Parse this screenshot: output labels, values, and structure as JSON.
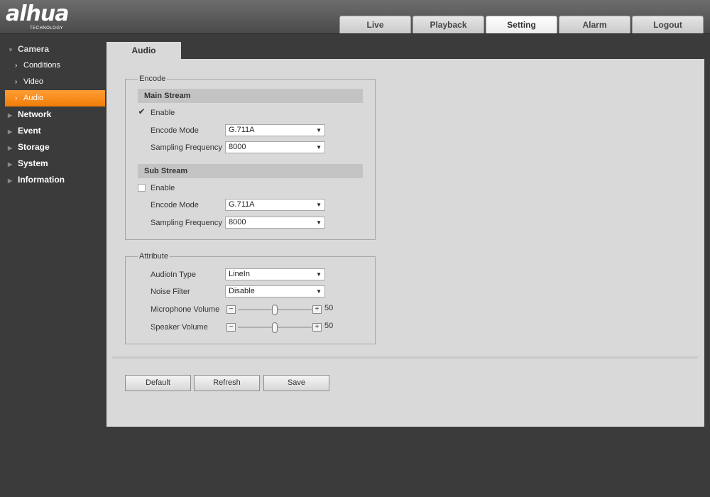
{
  "header": {
    "logo": "alhua",
    "logo_sub": "TECHNOLOGY",
    "tabs": [
      {
        "label": "Live"
      },
      {
        "label": "Playback"
      },
      {
        "label": "Setting"
      },
      {
        "label": "Alarm"
      },
      {
        "label": "Logout"
      }
    ],
    "active_tab": "Setting"
  },
  "sidebar": {
    "groups": [
      {
        "label": "Camera",
        "open": true,
        "items": [
          {
            "label": "Conditions"
          },
          {
            "label": "Video"
          },
          {
            "label": "Audio",
            "active": true
          }
        ]
      },
      {
        "label": "Network"
      },
      {
        "label": "Event"
      },
      {
        "label": "Storage"
      },
      {
        "label": "System"
      },
      {
        "label": "Information"
      }
    ]
  },
  "page": {
    "tab_label": "Audio",
    "encode": {
      "legend": "Encode",
      "main_stream": {
        "heading": "Main Stream",
        "enable_label": "Enable",
        "enabled": true,
        "encode_mode_label": "Encode Mode",
        "encode_mode": "G.711A",
        "sampling_label": "Sampling Frequency",
        "sampling": "8000"
      },
      "sub_stream": {
        "heading": "Sub Stream",
        "enable_label": "Enable",
        "enabled": false,
        "encode_mode_label": "Encode Mode",
        "encode_mode": "G.711A",
        "sampling_label": "Sampling Frequency",
        "sampling": "8000"
      }
    },
    "attribute": {
      "legend": "Attribute",
      "audioin_type_label": "AudioIn Type",
      "audioin_type": "LineIn",
      "noise_filter_label": "Noise Filter",
      "noise_filter": "Disable",
      "mic_volume_label": "Microphone Volume",
      "mic_volume": "50",
      "speaker_volume_label": "Speaker Volume",
      "speaker_volume": "50",
      "minus": "−",
      "plus": "+"
    },
    "buttons": {
      "default": "Default",
      "refresh": "Refresh",
      "save": "Save"
    }
  },
  "colors": {
    "accent": "#f58a1f",
    "panel": "#d9d9d9",
    "background": "#3b3b3b"
  }
}
